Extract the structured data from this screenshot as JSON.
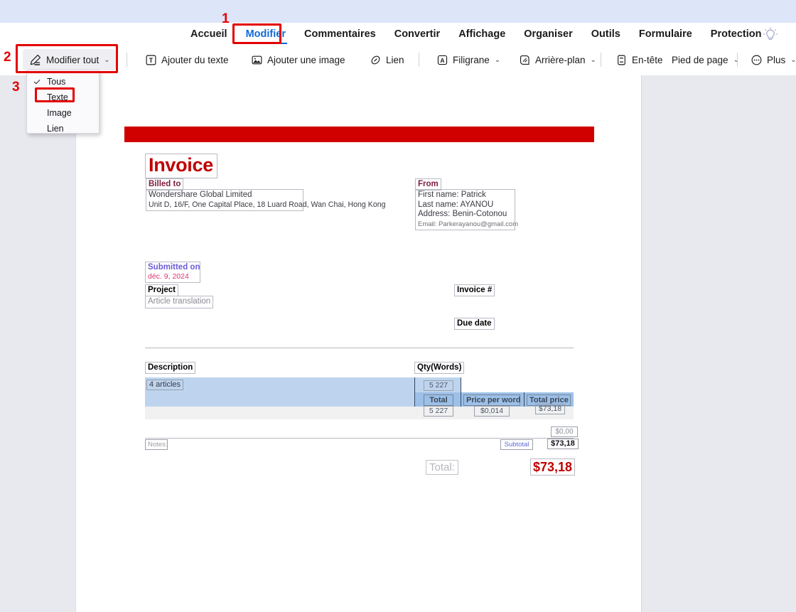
{
  "app": {
    "menu_tabs": [
      {
        "label": "Accueil",
        "active": false
      },
      {
        "label": "Modifier",
        "active": true
      },
      {
        "label": "Commentaires",
        "active": false
      },
      {
        "label": "Convertir",
        "active": false
      },
      {
        "label": "Affichage",
        "active": false
      },
      {
        "label": "Organiser",
        "active": false
      },
      {
        "label": "Outils",
        "active": false
      },
      {
        "label": "Formulaire",
        "active": false
      },
      {
        "label": "Protection",
        "active": false
      }
    ],
    "bulb_icon": "lightbulb-icon"
  },
  "toolbar": {
    "edit_all": {
      "label": "Modifier tout",
      "icon": "pencil-edit-icon",
      "caret": "⌄",
      "selected": true
    },
    "add_text": {
      "label": "Ajouter du texte",
      "icon": "text-box-icon"
    },
    "add_image": {
      "label": "Ajouter une image",
      "icon": "image-icon"
    },
    "link": {
      "label": "Lien",
      "icon": "link-icon"
    },
    "watermark": {
      "label": "Filigrane",
      "icon": "watermark-a-icon",
      "caret": "⌄"
    },
    "background": {
      "label": "Arrière-plan",
      "icon": "background-icon",
      "caret": "⌄"
    },
    "header": {
      "label": "En-tête",
      "icon": "header-footer-icon"
    },
    "footer": {
      "label": "Pied de page",
      "caret": "⌄"
    },
    "more": {
      "label": "Plus",
      "icon": "more-dots-icon",
      "caret": "⌄"
    }
  },
  "dropdown": {
    "items": [
      {
        "label": "Tous",
        "checked": true
      },
      {
        "label": "Texte",
        "checked": false,
        "highlighted": true
      },
      {
        "label": "Image",
        "checked": false
      },
      {
        "label": "Lien",
        "checked": false
      }
    ],
    "check_glyph": "✓"
  },
  "annotations": [
    {
      "number": "1",
      "target": "modifier-tab"
    },
    {
      "number": "2",
      "target": "modifier-tout-button"
    },
    {
      "number": "3",
      "target": "dropdown-item-texte"
    }
  ],
  "invoice": {
    "title": "Invoice",
    "billed_to_label": "Billed to",
    "billed_to_line1": "Wondershare Global Limited",
    "billed_to_line2": "Unit D, 16/F, One Capital Place, 18 Luard Road, Wan Chai, Hong Kong",
    "from_label": "From",
    "from_first_name": "First name: Patrick",
    "from_last_name": "Last name: AYANOU",
    "from_address": "Address: Benin-Cotonou",
    "from_email": "Email: Parkerayanou@gmail.com",
    "submitted_on_label": "Submitted on",
    "submitted_on_value": "déc. 9, 2024",
    "project_label": "Project",
    "project_value": "Article translation",
    "invoice_number_label": "Invoice #",
    "due_date_label": "Due date",
    "table": {
      "col_description": "Description",
      "col_qty": "Qty(Words)",
      "row_description": "4 articles",
      "row_qty": "5 227",
      "col_total": "Total",
      "col_price_per_word": "Price per word",
      "col_total_price": "Total price",
      "val_total": "5 227",
      "val_price_per_word": "$0,014",
      "val_total_price": "$73,18"
    },
    "zero_amount": "$0,00",
    "notes_label": "Notes:",
    "subtotal_label": "Subtotal",
    "subtotal_value": "$73,18",
    "total_label": "Total:",
    "total_value": "$73,18"
  },
  "colors": {
    "accent_blue": "#1169d8",
    "annotation_red": "#e40000",
    "invoice_red": "#c00000",
    "band_red": "#d10000",
    "table_blue": "#bed4ee",
    "table_blue_dark": "#9cc0e8",
    "top_strip": "#dde5f8",
    "workspace": "#e7e9ee"
  }
}
